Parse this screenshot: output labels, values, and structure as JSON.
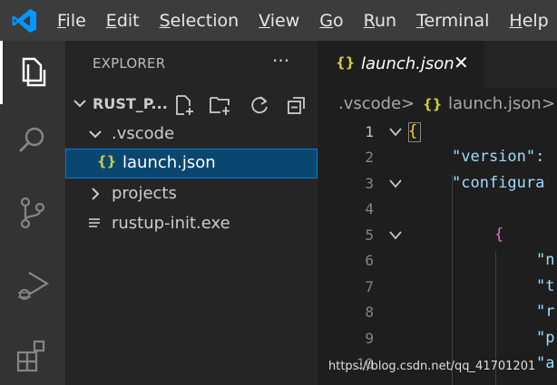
{
  "menu": [
    "File",
    "Edit",
    "Selection",
    "View",
    "Go",
    "Run",
    "Terminal",
    "Help"
  ],
  "menu_mnemonics": [
    "F",
    "E",
    "S",
    "V",
    "G",
    "R",
    "T",
    "H"
  ],
  "activity_icons": [
    "explorer-icon",
    "search-icon",
    "source-control-icon",
    "run-debug-icon",
    "extensions-icon"
  ],
  "sidebar": {
    "title": "EXPLORER",
    "more": "···",
    "section": "RUST_P...",
    "tree": [
      {
        "label": ".vscode",
        "kind": "folder-open"
      },
      {
        "label": "launch.json",
        "kind": "json",
        "selected": true
      },
      {
        "label": "projects",
        "kind": "folder-closed"
      },
      {
        "label": "rustup-init.exe",
        "kind": "file"
      }
    ]
  },
  "tab": {
    "label": "launch.json",
    "icon": "{}",
    "close": "✕"
  },
  "breadcrumb": [
    ".vscode",
    "launch.json"
  ],
  "breadcrumb_sep": ">",
  "code": {
    "line_numbers": [
      "1",
      "2",
      "3",
      "4",
      "5",
      "6",
      "7",
      "8",
      "9",
      "10"
    ],
    "lines": [
      "{",
      "\"version\":",
      "\"configura",
      "",
      "{",
      "\"n",
      "\"t",
      "\"r",
      "\"p",
      "\"a"
    ]
  },
  "watermark": "https://blog.csdn.net/qq_41701201",
  "colors": {
    "accent": "#007acc",
    "selection": "#094771",
    "json_icon": "#cbcb41"
  }
}
